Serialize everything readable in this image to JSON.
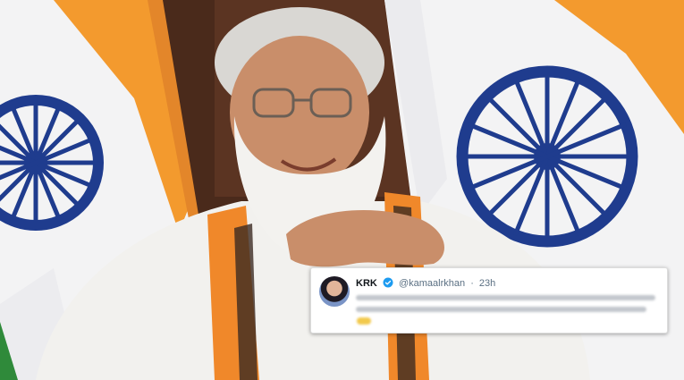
{
  "tweet": {
    "display_name": "KRK",
    "handle": "@kamaalrkhan",
    "separator": "·",
    "timestamp": "23h",
    "verified_icon": "verified-badge-icon",
    "body_state": "blurred"
  },
  "colors": {
    "flag_saffron": "#f39a2e",
    "flag_white": "#f3f3f4",
    "flag_green": "#2f8a3a",
    "chakra_navy": "#1f3c8e",
    "verified_blue": "#1d9bf0",
    "card_border": "#dcdcdc"
  }
}
